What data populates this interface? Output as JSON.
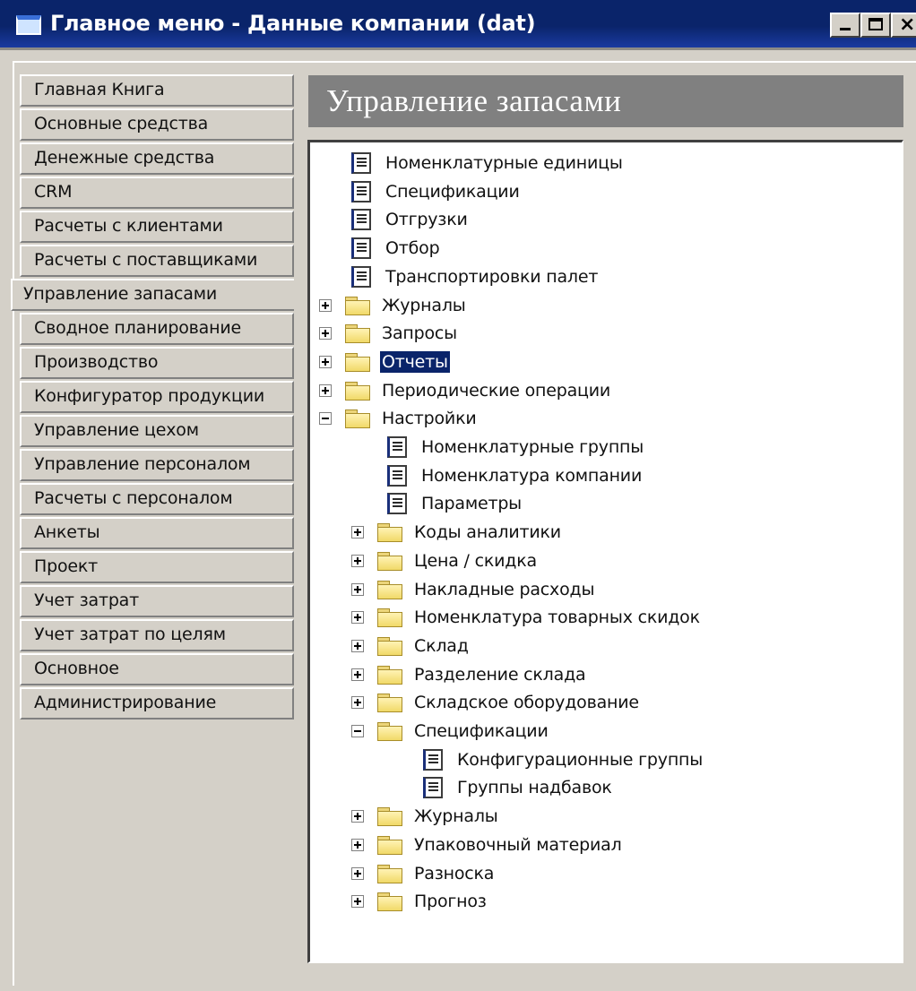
{
  "window": {
    "title": "Главное меню - Данные компании (dat)",
    "buttons": {
      "minimize": "minimize",
      "maximize": "maximize",
      "close": "×"
    }
  },
  "sidebar": {
    "items": [
      {
        "label": "Главная Книга"
      },
      {
        "label": "Основные средства"
      },
      {
        "label": "Денежные средства"
      },
      {
        "label": "CRM"
      },
      {
        "label": "Расчеты с клиентами"
      },
      {
        "label": "Расчеты с поставщиками"
      },
      {
        "label": "Управление запасами",
        "active": true
      },
      {
        "label": "Сводное планирование"
      },
      {
        "label": "Производство"
      },
      {
        "label": "Конфигуратор продукции"
      },
      {
        "label": "Управление цехом"
      },
      {
        "label": "Управление персоналом"
      },
      {
        "label": "Расчеты с персоналом"
      },
      {
        "label": "Анкеты"
      },
      {
        "label": "Проект"
      },
      {
        "label": "Учет затрат"
      },
      {
        "label": "Учет затрат по целям"
      },
      {
        "label": "Основное"
      },
      {
        "label": "Администрирование"
      }
    ]
  },
  "panel": {
    "title": "Управление запасами",
    "tree": [
      {
        "label": "Номенклатурные единицы",
        "type": "form",
        "level": 1
      },
      {
        "label": "Спецификации",
        "type": "form",
        "level": 1
      },
      {
        "label": "Отгрузки",
        "type": "form",
        "level": 1
      },
      {
        "label": "Отбор",
        "type": "form",
        "level": 1
      },
      {
        "label": "Транспортировки палет",
        "type": "form",
        "level": 1
      },
      {
        "label": "Журналы",
        "type": "folder",
        "level": 0,
        "state": "collapsed"
      },
      {
        "label": "Запросы",
        "type": "folder",
        "level": 0,
        "state": "collapsed"
      },
      {
        "label": "Отчеты",
        "type": "folder",
        "level": 0,
        "state": "collapsed",
        "selected": true
      },
      {
        "label": "Периодические операции",
        "type": "folder",
        "level": 0,
        "state": "collapsed"
      },
      {
        "label": "Настройки",
        "type": "folder",
        "level": 0,
        "state": "expanded"
      },
      {
        "label": "Номенклатурные группы",
        "type": "form",
        "level": 2
      },
      {
        "label": "Номенклатура компании",
        "type": "form",
        "level": 2
      },
      {
        "label": "Параметры",
        "type": "form",
        "level": 2
      },
      {
        "label": "Коды аналитики",
        "type": "folder",
        "level": 1,
        "state": "collapsed"
      },
      {
        "label": "Цена / скидка",
        "type": "folder",
        "level": 1,
        "state": "collapsed"
      },
      {
        "label": "Накладные расходы",
        "type": "folder",
        "level": 1,
        "state": "collapsed"
      },
      {
        "label": "Номенклатура товарных скидок",
        "type": "folder",
        "level": 1,
        "state": "collapsed"
      },
      {
        "label": "Склад",
        "type": "folder",
        "level": 1,
        "state": "collapsed"
      },
      {
        "label": "Разделение склада",
        "type": "folder",
        "level": 1,
        "state": "collapsed"
      },
      {
        "label": "Складское оборудование",
        "type": "folder",
        "level": 1,
        "state": "collapsed"
      },
      {
        "label": "Спецификации",
        "type": "folder",
        "level": 1,
        "state": "expanded"
      },
      {
        "label": "Конфигурационные группы",
        "type": "form",
        "level": 3
      },
      {
        "label": "Группы надбавок",
        "type": "form",
        "level": 3
      },
      {
        "label": "Журналы",
        "type": "folder",
        "level": 1,
        "state": "collapsed"
      },
      {
        "label": "Упаковочный материал",
        "type": "folder",
        "level": 1,
        "state": "collapsed"
      },
      {
        "label": "Разноска",
        "type": "folder",
        "level": 1,
        "state": "collapsed"
      },
      {
        "label": "Прогноз",
        "type": "folder",
        "level": 1,
        "state": "collapsed"
      }
    ]
  }
}
